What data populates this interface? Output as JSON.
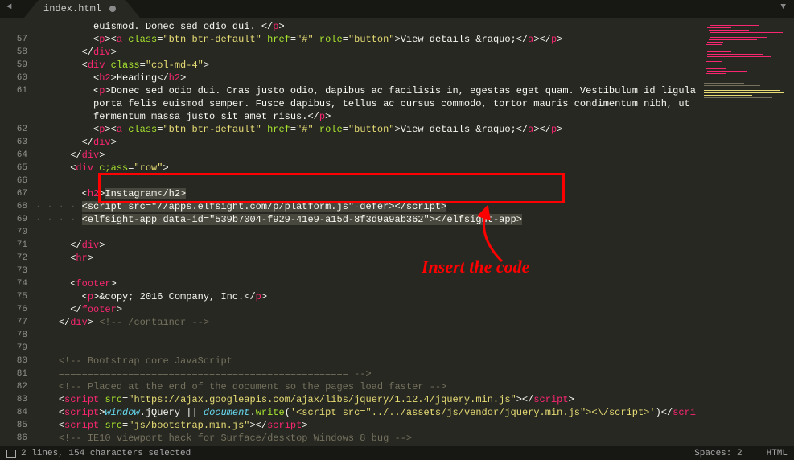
{
  "tab": {
    "filename": "index.html"
  },
  "gutter": [
    "",
    "57",
    "58",
    "59",
    "60",
    "61",
    "",
    "",
    "62",
    "63",
    "64",
    "65",
    "66",
    "67",
    "68",
    "69",
    "70",
    "71",
    "72",
    "73",
    "74",
    "75",
    "76",
    "77",
    "78",
    "79",
    "80",
    "81",
    "82",
    "83",
    "84",
    "85",
    "86",
    ""
  ],
  "code": {
    "l0": "euismod. Donec sed odio dui. ",
    "l1a": "View details &raquo;",
    "l3": "col-md-4",
    "l4": "Heading",
    "l5": "Donec sed odio dui. Cras justo odio, dapibus ac facilisis in, egestas eget quam. Vestibulum id ligula",
    "l6": "porta felis euismod semper. Fusce dapibus, tellus ac cursus commodo, tortor mauris condimentum nibh, ut",
    "l7": "fermentum massa justo sit amet risus.",
    "l8": "View details &raquo;",
    "l11": "row",
    "l13": "Instagram",
    "l14_src": "//apps.elfsight.com/p/platform.js",
    "l15_id": "539b7004-f929-41e9-a15d-8f3d9a9ab362",
    "l21a": "&copy;",
    "l21b": " 2016 Company, Inc.",
    "l23": " /container ",
    "l26": " Bootstrap core JavaScript",
    "l27": "    ================================================== ",
    "l28": " Placed at the end of the document so the pages load faster ",
    "l29": "https://ajax.googleapis.com/ajax/libs/jquery/1.12.4/jquery.min.js",
    "l30a": "window",
    "l30b": ".jQuery || ",
    "l30c": "document",
    "l30d": ".write(",
    "l30e": "'<script src=\"../../assets/js/vendor/jquery.min.js\"><\\/script>'",
    "l30f": ")",
    "l31": "js/bootstrap.min.js",
    "l32": " IE10 viewport hack for Surface/desktop Windows 8 bug "
  },
  "annotation": "Insert the code",
  "status": {
    "selection": "2 lines, 154 characters selected",
    "spaces": "Spaces: 2",
    "syntax": "HTML"
  }
}
